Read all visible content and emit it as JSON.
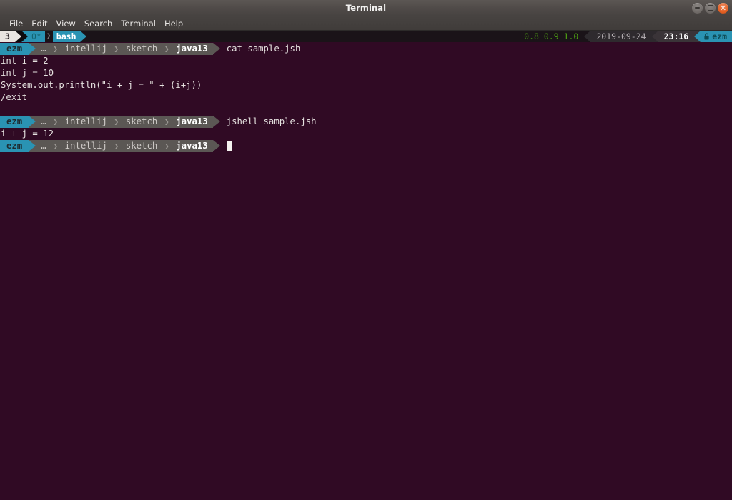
{
  "window": {
    "title": "Terminal",
    "controls": [
      {
        "name": "minimize",
        "glyph": "dash"
      },
      {
        "name": "maximize",
        "glyph": "square"
      },
      {
        "name": "close",
        "glyph": "x"
      }
    ]
  },
  "menubar": {
    "items": [
      "File",
      "Edit",
      "View",
      "Search",
      "Terminal",
      "Help"
    ]
  },
  "statusline": {
    "session": "3",
    "window_index": "0*",
    "window_name": "bash",
    "load": "0.8 0.9 1.0",
    "date": "2019-09-24",
    "time": "23:16",
    "host": "ezm",
    "lock_icon": "lock-icon",
    "separator": "❯"
  },
  "terminal": {
    "prompt": {
      "user": "ezm",
      "ellipsis": "…",
      "path_segments": [
        "intellij",
        "sketch",
        "java13"
      ],
      "separator": "❯"
    },
    "entries": [
      {
        "type": "command",
        "command": "cat sample.jsh"
      },
      {
        "type": "output",
        "text": "int i = 2"
      },
      {
        "type": "output",
        "text": "int j = 10"
      },
      {
        "type": "output",
        "text": "System.out.println(\"i + j = \" + (i+j))"
      },
      {
        "type": "output",
        "text": "/exit"
      },
      {
        "type": "blank",
        "text": ""
      },
      {
        "type": "command",
        "command": "jshell sample.jsh"
      },
      {
        "type": "output",
        "text": "i + j = 12"
      },
      {
        "type": "command_cursor",
        "command": ""
      }
    ]
  },
  "colors": {
    "terminal_bg": "#300a24",
    "accent_cyan": "#2a93b3",
    "statusbar_bg": "#1a1318",
    "load_green": "#4fa512",
    "close_orange": "#e35f22",
    "path_gray": "#5b5754"
  }
}
